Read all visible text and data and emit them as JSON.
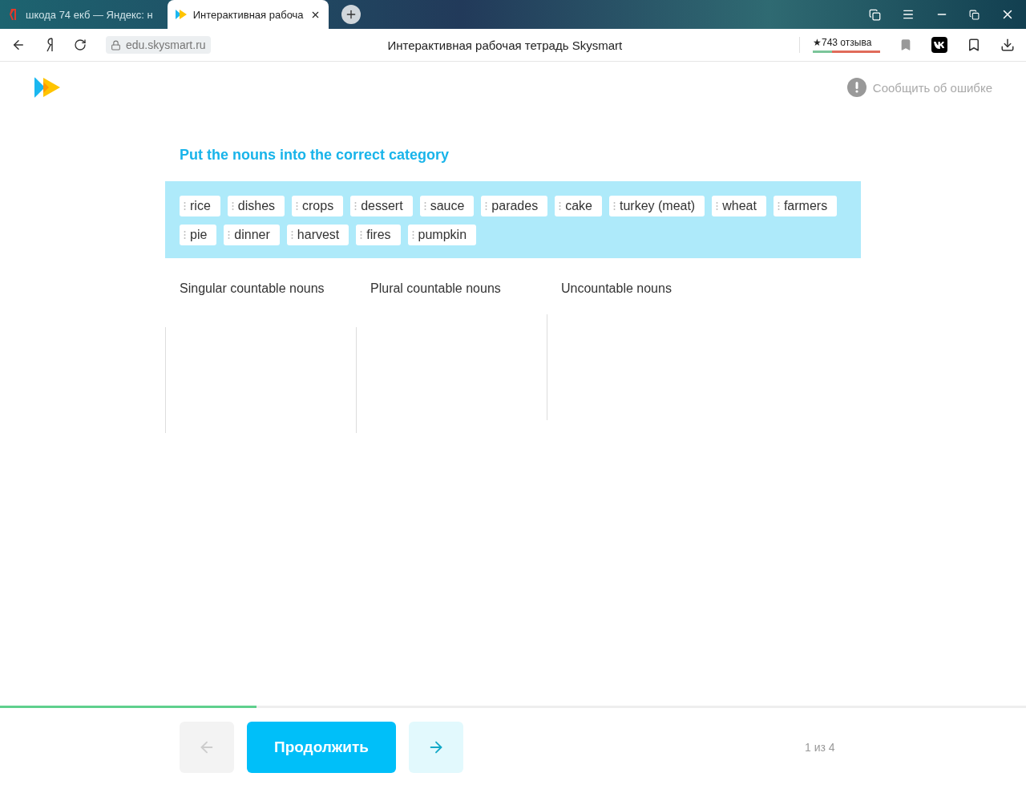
{
  "browser": {
    "tabs": [
      {
        "title": "шкода 74 екб — Яндекс: н",
        "selected": false
      },
      {
        "title": "Интерактивная рабоча",
        "selected": true
      }
    ],
    "url": "edu.skysmart.ru",
    "page_title": "Интерактивная рабочая тетрадь Skysmart",
    "rating": "★743 отзыва"
  },
  "header": {
    "report_link": "Сообщить об ошибке"
  },
  "task": {
    "title": "Put the nouns into the correct category",
    "words": [
      "rice",
      "dishes",
      "crops",
      "dessert",
      "sauce",
      "parades",
      "cake",
      "turkey (meat)",
      "wheat",
      "farmers",
      "pie",
      "dinner",
      "harvest",
      "fires",
      "pumpkin"
    ],
    "categories": [
      "Singular countable nouns",
      "Plural countable nouns",
      "Uncountable nouns"
    ]
  },
  "footer": {
    "progress": {
      "level": 0.25
    },
    "prev": {
      "disabled": true
    },
    "continue": "Продолжить",
    "next": {
      "disabled": false
    },
    "page_counter": "1 из 4"
  }
}
